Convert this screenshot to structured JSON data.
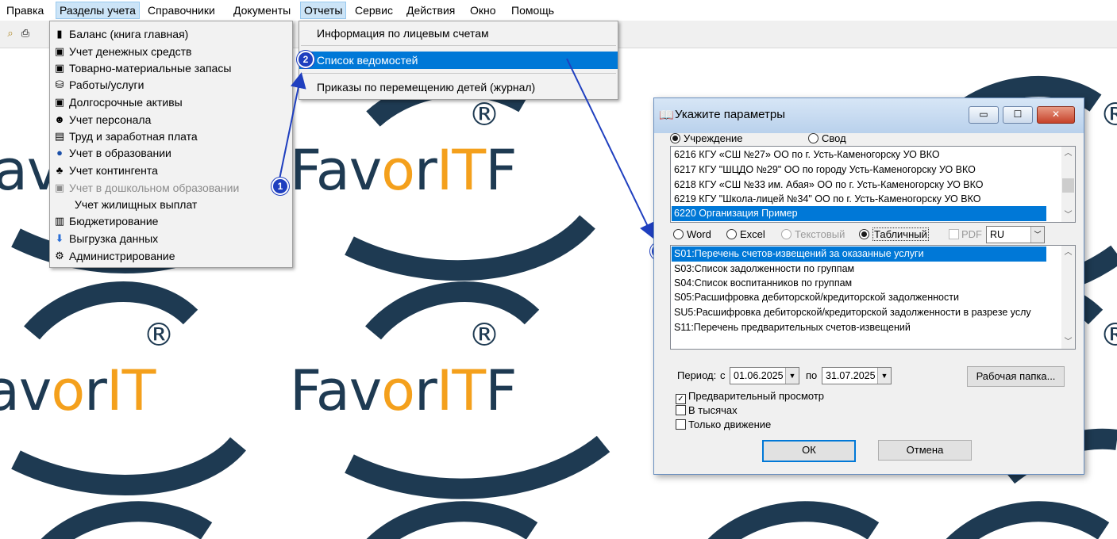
{
  "background": {
    "brand": "FavorIT",
    "registered": "®",
    "word_f": "F",
    "word_av": "av",
    "word_o": "o",
    "word_r": "r",
    "word_it": "IT",
    "colors": {
      "navy": "#1e3a52",
      "orange": "#f4a01c"
    }
  },
  "menubar": {
    "items": [
      {
        "label": "Правка"
      },
      {
        "label": "Разделы учета"
      },
      {
        "label": "Справочники"
      },
      {
        "label": "Документы"
      },
      {
        "label": "Отчеты"
      },
      {
        "label": "Сервис"
      },
      {
        "label": "Действия"
      },
      {
        "label": "Окно"
      },
      {
        "label": "Помощь"
      }
    ]
  },
  "sections_menu": {
    "items": [
      {
        "label": "Баланс (книга главная)",
        "icon": "book-icon",
        "glyph": "▮",
        "disabled": false
      },
      {
        "label": "Учет денежных средств",
        "icon": "money-doc-icon",
        "glyph": "▣",
        "disabled": false
      },
      {
        "label": "Товарно-материальные запасы",
        "icon": "inventory-icon",
        "glyph": "▣",
        "disabled": false
      },
      {
        "label": "Работы/услуги",
        "icon": "services-icon",
        "glyph": "⛁",
        "disabled": false
      },
      {
        "label": "Долгосрочные активы",
        "icon": "assets-icon",
        "glyph": "▣",
        "disabled": false
      },
      {
        "label": "Учет персонала",
        "icon": "personnel-icon",
        "glyph": "☻",
        "disabled": false
      },
      {
        "label": "Труд и заработная плата",
        "icon": "salary-icon",
        "glyph": "▤",
        "disabled": false
      },
      {
        "label": "Учет в образовании",
        "icon": "education-icon",
        "glyph": "●",
        "disabled": false
      },
      {
        "label": "Учет контингента",
        "icon": "contingent-icon",
        "glyph": "♣",
        "disabled": false
      },
      {
        "label": "Учет в дошкольном образовании",
        "icon": "preschool-icon",
        "glyph": "▣",
        "disabled": true
      },
      {
        "label": "Учет жилищных выплат",
        "icon": "",
        "glyph": "",
        "disabled": false
      },
      {
        "label": "Бюджетирование",
        "icon": "budget-icon",
        "glyph": "▥",
        "disabled": false
      },
      {
        "label": "Выгрузка данных",
        "icon": "export-icon",
        "glyph": "⬇",
        "disabled": false
      },
      {
        "label": "Администрирование",
        "icon": "admin-icon",
        "glyph": "⚙",
        "disabled": false
      }
    ]
  },
  "reports_menu": {
    "items": [
      {
        "label": "Информация по лицевым счетам"
      },
      {
        "label": "Список ведомостей"
      },
      {
        "label": "Приказы по перемещению детей (журнал)"
      }
    ]
  },
  "callouts": [
    "1",
    "2",
    "3"
  ],
  "dialog": {
    "title": "Укажите параметры",
    "title_icon": "📖",
    "scope": {
      "institution": "Учреждение",
      "summary": "Свод",
      "selected": "institution"
    },
    "institutions": [
      {
        "code": "6216",
        "name": "КГУ «СШ №27» ОО по г. Усть-Каменогорску УО ВКО"
      },
      {
        "code": "6217",
        "name": "КГУ \"ШЦДО №29\" ОО по городу Усть-Каменогорску УО ВКО"
      },
      {
        "code": "6218",
        "name": "КГУ «СШ №33 им. Абая» ОО по г. Усть-Каменогорску УО ВКО"
      },
      {
        "code": "6219",
        "name": "КГУ \"Школа-лицей №34\" ОО по г. Усть-Каменогорску УО ВКО"
      },
      {
        "code": "6220",
        "name": "Организация Пример"
      }
    ],
    "formats": {
      "word": "Word",
      "excel": "Excel",
      "text": "Текстовый",
      "table": "Табличный",
      "selected": "table"
    },
    "pdf_label": "PDF",
    "language": "RU",
    "reports": [
      "S01:Перечень счетов-извещений за оказанные услуги",
      "S03:Список задолженности по группам",
      "S04:Список воспитанников по группам",
      "S05:Расшифровка дебиторской/кредиторской задолженности",
      "SU5:Расшифровка дебиторской/кредиторской задолженности в разрезе услу",
      "S11:Перечень предварительных счетов-извещений"
    ],
    "period_label": "Период:",
    "from_label": "с",
    "date_from": "01.06.2025",
    "to_label": "по",
    "date_to": "31.07.2025",
    "workfolder_button": "Рабочая папка...",
    "options": {
      "preview": {
        "label": "Предварительный просмотр",
        "checked": true
      },
      "thousands": {
        "label": "В тысячах",
        "checked": false
      },
      "movement_only": {
        "label": "Только движение",
        "checked": false
      }
    },
    "ok_button": "ОК",
    "cancel_button": "Отмена",
    "window_buttons": {
      "minimize": "▭",
      "maximize": "☐",
      "close": "✕"
    }
  }
}
